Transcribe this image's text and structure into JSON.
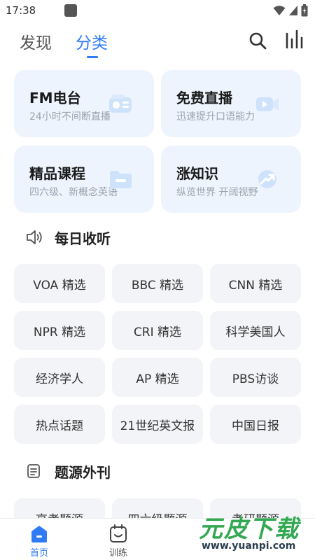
{
  "status_bar": {
    "time": "17:38"
  },
  "top_tabs": [
    {
      "label": "发现",
      "active": false
    },
    {
      "label": "分类",
      "active": true
    }
  ],
  "cards": [
    {
      "title": "FM电台",
      "subtitle": "24小时不间断直播",
      "icon": "radio-icon"
    },
    {
      "title": "免费直播",
      "subtitle": "迅速提升口语能力",
      "icon": "video-camera-icon"
    },
    {
      "title": "精品课程",
      "subtitle": "四六级、新概念英语",
      "icon": "folder-icon"
    },
    {
      "title": "涨知识",
      "subtitle": "纵览世界 开阔视野",
      "icon": "trend-arrow-icon"
    }
  ],
  "daily_listen": {
    "title": "每日收听",
    "items": [
      "VOA 精选",
      "BBC 精选",
      "CNN 精选",
      "NPR 精选",
      "CRI 精选",
      "科学美国人",
      "经济学人",
      "AP 精选",
      "PBS访谈",
      "热点话题",
      "21世纪英文报",
      "中国日报"
    ]
  },
  "question_source": {
    "title": "题源外刊",
    "items": [
      "高考题源",
      "四六级题源",
      "考研题源"
    ]
  },
  "bottom_nav": [
    {
      "label": "首页",
      "active": true
    },
    {
      "label": "训练",
      "active": false
    }
  ],
  "watermark": {
    "main": "元皮下载",
    "url": "www.yuanpi.com"
  },
  "colors": {
    "accent": "#2f7bf6",
    "card_bg": "#eef4fd",
    "chip_bg": "#f3f4f7"
  }
}
